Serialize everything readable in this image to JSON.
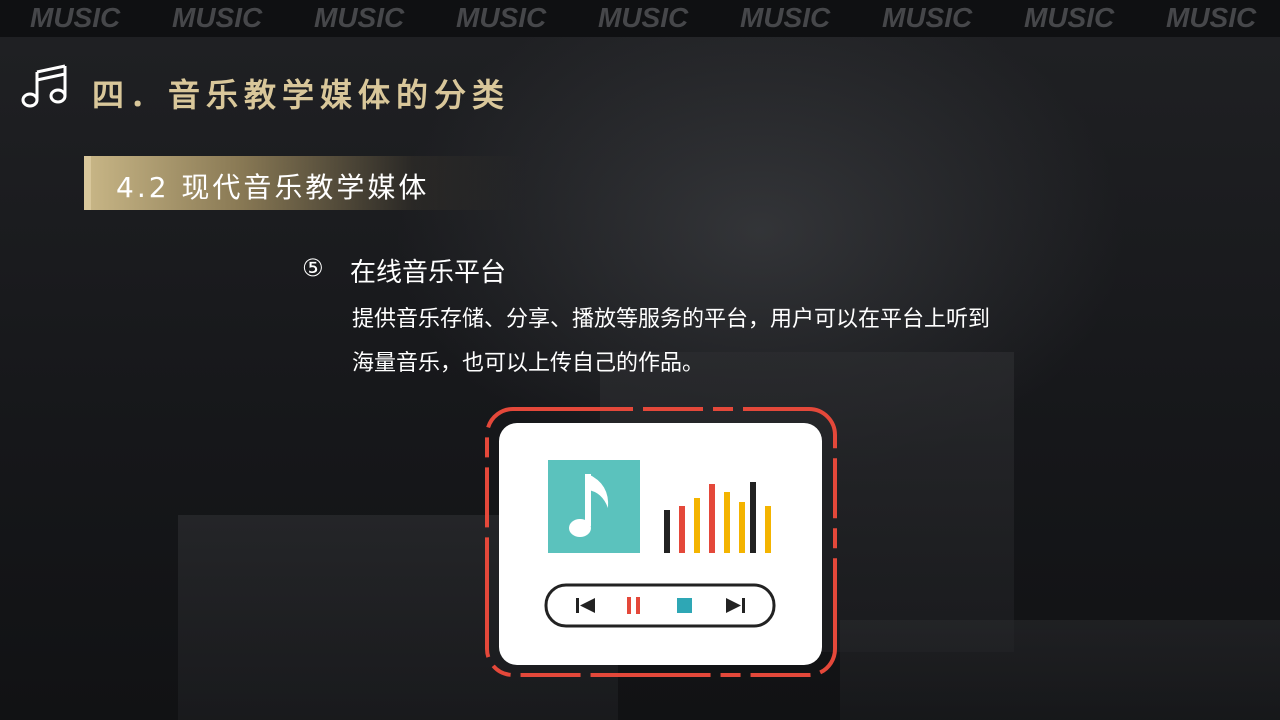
{
  "banner": {
    "word": "MUSIC"
  },
  "header": {
    "title": "四．音乐教学媒体的分类"
  },
  "section": {
    "subtitle": "4.2 现代音乐教学媒体"
  },
  "item": {
    "number": "⑤",
    "title": "在线音乐平台",
    "description": "提供音乐存储、分享、播放等服务的平台，用户可以在平台上听到海量音乐，也可以上传自己的作品。"
  },
  "illustration": {
    "icons": [
      "music-note-icon",
      "equalizer-icon",
      "previous-icon",
      "pause-icon",
      "stop-icon",
      "next-icon"
    ],
    "colors": {
      "frame": "#e4483a",
      "card": "#ffffff",
      "tile": "#5bc2bd",
      "bar_black": "#222222",
      "bar_red": "#e4483a",
      "bar_yellow": "#f4b400",
      "stop": "#2ea7b5"
    }
  },
  "theme": {
    "gold": "#d9c79a",
    "background": "#1a1b1d"
  }
}
